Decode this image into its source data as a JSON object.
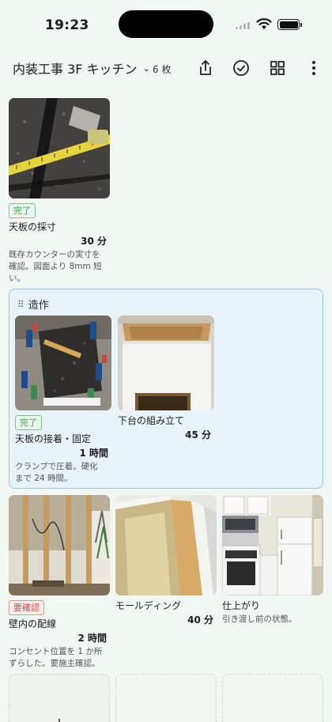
{
  "status_bar": {
    "time": "19:23"
  },
  "header": {
    "title": "内装工事 3F キッチン",
    "count": "6 枚",
    "actions": [
      "share-icon",
      "check-circle-icon",
      "grid-icon",
      "more-vertical-icon"
    ]
  },
  "cards": {
    "c1": {
      "badge": "完了",
      "name": "天板の採寸",
      "duration": "30 分",
      "note_l1": "既存カウンターの実寸を",
      "note_l2": "確認。図面より 8mm 短",
      "note_l3": "い。"
    },
    "c2": {
      "badge": "完了",
      "name": "天板の接着・固定",
      "duration": "1 時間",
      "note_l1": "クランプで圧着。硬化",
      "note_l2": "まで 24 時間。"
    },
    "c3": {
      "name": "下台の組み立て",
      "duration": "45 分"
    },
    "c4": {
      "badge": "要確認",
      "name": "壁内の配線",
      "duration": "2 時間",
      "note_l1": "コンセント位置を 1 か所",
      "note_l2": "ずらした。要施主確認。"
    },
    "c5": {
      "name": "モールディング",
      "duration": "40 分"
    },
    "c6": {
      "name": "仕上がり",
      "note_l1": "引き渡し前の状態。"
    }
  },
  "group": {
    "label": "造作"
  },
  "colors": {
    "background": "#f1f8f4",
    "group_border": "#8ec7e6",
    "badge_done": "#3c9a4f",
    "badge_check": "#d24b4b"
  }
}
